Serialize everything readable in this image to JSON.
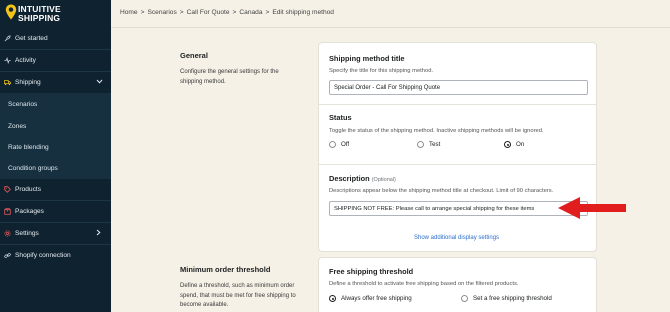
{
  "brand": {
    "line1": "INTUITIVE",
    "line2": "SHIPPING",
    "accent": "#f0c419"
  },
  "sidebar": {
    "items": [
      {
        "label": "Get started",
        "icon": "rocket-icon"
      },
      {
        "label": "Activity",
        "icon": "activity-icon"
      },
      {
        "label": "Shipping",
        "icon": "truck-icon",
        "expanded": true
      },
      {
        "label": "Products",
        "icon": "tag-icon"
      },
      {
        "label": "Packages",
        "icon": "package-icon"
      },
      {
        "label": "Settings",
        "icon": "gear-icon"
      },
      {
        "label": "Shopify connection",
        "icon": "link-icon"
      }
    ],
    "subitems": [
      "Scenarios",
      "Zones",
      "Rate blending",
      "Condition groups"
    ]
  },
  "breadcrumb": [
    "Home",
    ">",
    "Scenarios",
    ">",
    "Call For Quote",
    ">",
    "Canada",
    ">",
    "Edit shipping method"
  ],
  "general": {
    "title": "General",
    "desc": "Configure the general settings for the shipping method."
  },
  "method_title": {
    "title": "Shipping method title",
    "desc": "Specify the title for this shipping method.",
    "value": "Special Order - Call For Shipping Quote"
  },
  "status": {
    "title": "Status",
    "desc": "Toggle the status of the shipping method. Inactive shipping methods will be ignored.",
    "options": [
      "Off",
      "Test",
      "On"
    ],
    "selected": "On"
  },
  "description": {
    "title": "Description",
    "optional": "(Optional)",
    "desc": "Descriptions appear below the shipping method title at checkout. Limit of 90 characters.",
    "value": "SHIPPING NOT FREE: Please call to arrange special shipping for these items",
    "link": "Show additional display settings"
  },
  "min_order": {
    "title": "Minimum order threshold",
    "desc": "Define a threshold, such as minimum order spend, that must be met for free shipping to become available."
  },
  "free_shipping": {
    "title": "Free shipping threshold",
    "desc": "Define a threshold to activate free shipping based on the filtered products.",
    "options": [
      "Always offer free shipping",
      "Set a free shipping threshold"
    ],
    "selected": "Always offer free shipping"
  },
  "colors": {
    "sidebar": "#0f2230",
    "annotation_arrow": "#e11d1d",
    "link": "#2c6ecb"
  }
}
